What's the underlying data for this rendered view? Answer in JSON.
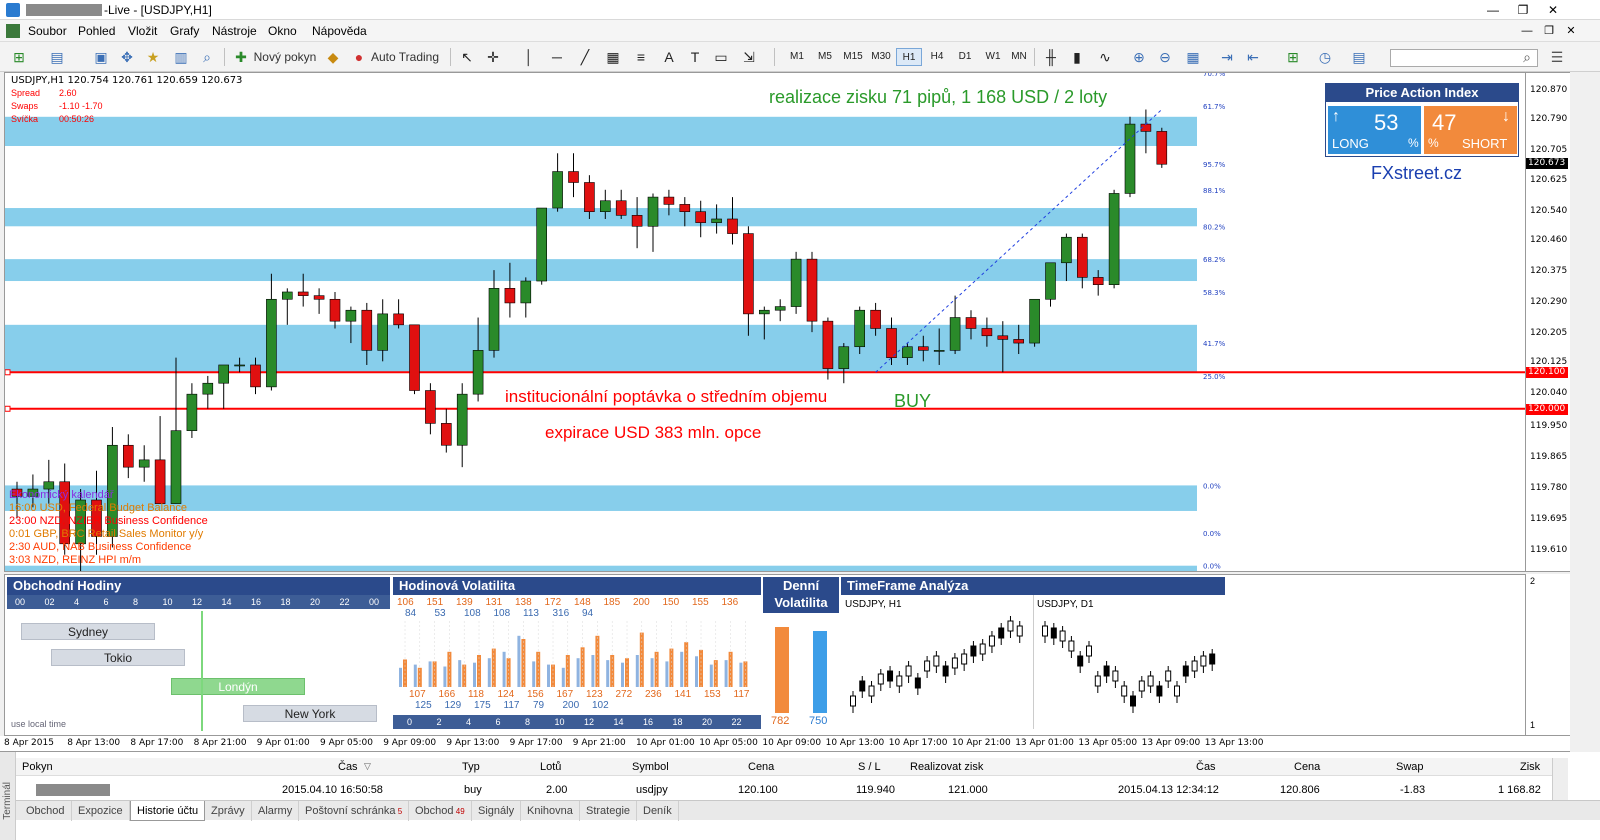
{
  "window": {
    "title_suffix": "-Live - [USDJPY,H1]",
    "controls": [
      "—",
      "❐",
      "✕"
    ],
    "mdi_controls": [
      "—",
      "❐",
      "✕"
    ]
  },
  "menu": [
    "Soubor",
    "Pohled",
    "Vložit",
    "Grafy",
    "Nástroje",
    "Okno",
    "Nápověda"
  ],
  "toolbar": {
    "new_order": "Nový pokyn",
    "auto_trading": "Auto Trading",
    "timeframes": [
      "M1",
      "M5",
      "M15",
      "M30",
      "H1",
      "H4",
      "D1",
      "W1",
      "MN"
    ],
    "active_timeframe": "H1"
  },
  "chart": {
    "header": "USDJPY,H1  120.754 120.761 120.659 120.673",
    "info": [
      {
        "label": "Spread",
        "value": "2.60"
      },
      {
        "label": "Swaps",
        "value": "-1.10 -1.70"
      },
      {
        "label": "Svíčka",
        "value": "00:50:26"
      }
    ],
    "annotations": {
      "profit": "realizace zisku 71 pipů, 1 168 USD / 2 loty",
      "demand": "institucionální poptávka o středním objemu",
      "expiry": "expirace USD 383 mln. opce",
      "buy": "BUY"
    },
    "price_ticks": [
      "120.870",
      "120.790",
      "120.705",
      "120.625",
      "120.540",
      "120.460",
      "120.375",
      "120.290",
      "120.205",
      "120.125",
      "120.040",
      "119.950",
      "119.865",
      "119.780",
      "119.695",
      "119.610"
    ],
    "price_tags": [
      {
        "label": "120.673",
        "color": "#000000"
      },
      {
        "label": "120.100",
        "color": "#ff0000"
      },
      {
        "label": "120.000",
        "color": "#ff0000"
      }
    ],
    "sub_axis": [
      "2",
      "1"
    ],
    "fib_labels": [
      "70.7%",
      "61.7%",
      "95.7%",
      "88.1%",
      "80.2%",
      "68.2%",
      "58.3%",
      "41.7%",
      "25.0%",
      "0.0%",
      "0.0%",
      "0.0%"
    ],
    "calendar_title": "Ekonomický kalendář",
    "calendar": [
      {
        "text": "16:00 USD, Federal Budget Balance",
        "color": "#e07b00"
      },
      {
        "text": "23:00 NZD, NZIER Business Confidence",
        "color": "#ff0000"
      },
      {
        "text": "0:01 GBP, BRC Retail Sales Monitor y/y",
        "color": "#e07b00"
      },
      {
        "text": "2:30 AUD, NAB Business Confidence",
        "color": "#ff3c00"
      },
      {
        "text": "3:03 NZD, REINZ HPI m/m",
        "color": "#ff3c00"
      }
    ]
  },
  "price_action_index": {
    "title": "Price Action Index",
    "long_value": "53",
    "short_value": "47",
    "pct": "%",
    "long_label": "LONG",
    "short_label": "SHORT",
    "brand": "FXstreet.cz",
    "colors": {
      "long": "#2f8fd8",
      "short": "#f28a3c"
    }
  },
  "trading_hours": {
    "title": "Obchodní Hodiny",
    "hours": [
      "00",
      "02",
      "4",
      "6",
      "8",
      "10",
      "12",
      "14",
      "16",
      "18",
      "20",
      "22",
      "00"
    ],
    "sessions": [
      "Sydney",
      "Tokio",
      "Londýn",
      "New York"
    ],
    "footer": "use local time"
  },
  "hourly_volatility": {
    "title": "Hodinová Volatilita",
    "top_orange": [
      "106",
      "151",
      "139",
      "131",
      "138",
      "172",
      "148",
      "185",
      "200",
      "150",
      "155",
      "136"
    ],
    "top_blue": [
      "84",
      "53",
      "108",
      "108",
      "113",
      "316",
      "94"
    ],
    "bottom_orange": [
      "107",
      "166",
      "118",
      "124",
      "156",
      "167",
      "123",
      "272",
      "236",
      "141",
      "153",
      "117"
    ],
    "bottom_blue": [
      "125",
      "129",
      "175",
      "117",
      "79",
      "200",
      "102"
    ],
    "axis": [
      "0",
      "2",
      "4",
      "6",
      "8",
      "10",
      "12",
      "14",
      "16",
      "18",
      "20",
      "22"
    ],
    "bars_orange": [
      0.43,
      0.3,
      0.4,
      0.55,
      0.35,
      0.5,
      0.6,
      0.45,
      0.75,
      0.55,
      0.35,
      0.5,
      0.62,
      0.8,
      0.5,
      0.45,
      0.85,
      0.55,
      0.6,
      0.7,
      0.58,
      0.42,
      0.55,
      0.4
    ],
    "bars_blue": [
      0.3,
      0.35,
      0.4,
      0.32,
      0.42,
      0.38,
      0.45,
      0.55,
      0.8,
      0.4,
      0.35,
      0.3,
      0.45,
      0.5,
      0.42,
      0.38,
      0.5,
      0.45,
      0.4,
      0.55,
      0.48,
      0.35,
      0.42,
      0.38
    ]
  },
  "daily_volatility": {
    "title": "Denní Volatilita",
    "orange_value": "782",
    "blue_value": "750"
  },
  "timeframe_analysis": {
    "title": "TimeFrame Analýza",
    "left_label": "USDJPY, H1",
    "right_label": "USDJPY, D1"
  },
  "time_axis": [
    "8 Apr 2015",
    "8 Apr 13:00",
    "8 Apr 17:00",
    "8 Apr 21:00",
    "9 Apr 01:00",
    "9 Apr 05:00",
    "9 Apr 09:00",
    "9 Apr 13:00",
    "9 Apr 17:00",
    "9 Apr 21:00",
    "10 Apr 01:00",
    "10 Apr 05:00",
    "10 Apr 09:00",
    "10 Apr 13:00",
    "10 Apr 17:00",
    "10 Apr 21:00",
    "13 Apr 01:00",
    "13 Apr 05:00",
    "13 Apr 09:00",
    "13 Apr 13:00"
  ],
  "terminal": {
    "side_label": "Terminál",
    "headers": [
      "Pokyn",
      "Čas",
      "Typ",
      "Lotů",
      "Symbol",
      "Cena",
      "S / L",
      "Realizovat zisk",
      "Čas",
      "Cena",
      "Swap",
      "Zisk"
    ],
    "row": [
      "2015.04.10 16:50:58",
      "buy",
      "2.00",
      "usdjpy",
      "120.100",
      "119.940",
      "121.000",
      "2015.04.13 12:34:12",
      "120.806",
      "-1.83",
      "1 168.82"
    ],
    "tabs": [
      {
        "label": "Obchod"
      },
      {
        "label": "Expozice"
      },
      {
        "label": "Historie účtu",
        "active": true
      },
      {
        "label": "Zprávy"
      },
      {
        "label": "Alarmy"
      },
      {
        "label": "Poštovní schránka",
        "badge": "5"
      },
      {
        "label": "Obchod",
        "badge": "49"
      },
      {
        "label": "Signály"
      },
      {
        "label": "Knihovna"
      },
      {
        "label": "Strategie"
      },
      {
        "label": "Deník"
      }
    ]
  },
  "candles": [
    {
      "o": 119.78,
      "h": 119.8,
      "l": 119.7,
      "c": 119.76
    },
    {
      "o": 119.76,
      "h": 119.82,
      "l": 119.73,
      "c": 119.78
    },
    {
      "o": 119.78,
      "h": 119.86,
      "l": 119.74,
      "c": 119.8
    },
    {
      "o": 119.8,
      "h": 119.85,
      "l": 119.6,
      "c": 119.63
    },
    {
      "o": 119.63,
      "h": 119.78,
      "l": 119.55,
      "c": 119.75
    },
    {
      "o": 119.75,
      "h": 119.83,
      "l": 119.6,
      "c": 119.65
    },
    {
      "o": 119.65,
      "h": 119.95,
      "l": 119.62,
      "c": 119.9
    },
    {
      "o": 119.9,
      "h": 119.93,
      "l": 119.81,
      "c": 119.84
    },
    {
      "o": 119.84,
      "h": 119.9,
      "l": 119.8,
      "c": 119.86
    },
    {
      "o": 119.86,
      "h": 119.98,
      "l": 119.78,
      "c": 119.74
    },
    {
      "o": 119.74,
      "h": 120.14,
      "l": 119.74,
      "c": 119.94
    },
    {
      "o": 119.94,
      "h": 120.07,
      "l": 119.92,
      "c": 120.04
    },
    {
      "o": 120.04,
      "h": 120.09,
      "l": 120.0,
      "c": 120.07
    },
    {
      "o": 120.07,
      "h": 120.1,
      "l": 120.0,
      "c": 120.12
    },
    {
      "o": 120.12,
      "h": 120.14,
      "l": 120.1,
      "c": 120.12
    },
    {
      "o": 120.12,
      "h": 120.14,
      "l": 120.04,
      "c": 120.06
    },
    {
      "o": 120.06,
      "h": 120.37,
      "l": 120.05,
      "c": 120.3
    },
    {
      "o": 120.3,
      "h": 120.33,
      "l": 120.23,
      "c": 120.32
    },
    {
      "o": 120.32,
      "h": 120.37,
      "l": 120.28,
      "c": 120.31
    },
    {
      "o": 120.31,
      "h": 120.33,
      "l": 120.26,
      "c": 120.3
    },
    {
      "o": 120.3,
      "h": 120.32,
      "l": 120.22,
      "c": 120.24
    },
    {
      "o": 120.24,
      "h": 120.28,
      "l": 120.18,
      "c": 120.27
    },
    {
      "o": 120.27,
      "h": 120.29,
      "l": 120.12,
      "c": 120.16
    },
    {
      "o": 120.16,
      "h": 120.3,
      "l": 120.13,
      "c": 120.26
    },
    {
      "o": 120.26,
      "h": 120.3,
      "l": 120.22,
      "c": 120.23
    },
    {
      "o": 120.23,
      "h": 120.23,
      "l": 120.04,
      "c": 120.05
    },
    {
      "o": 120.05,
      "h": 120.07,
      "l": 119.93,
      "c": 119.96
    },
    {
      "o": 119.96,
      "h": 120.0,
      "l": 119.88,
      "c": 119.9
    },
    {
      "o": 119.9,
      "h": 120.07,
      "l": 119.84,
      "c": 120.04
    },
    {
      "o": 120.04,
      "h": 120.25,
      "l": 120.02,
      "c": 120.16
    },
    {
      "o": 120.16,
      "h": 120.38,
      "l": 120.14,
      "c": 120.33
    },
    {
      "o": 120.33,
      "h": 120.4,
      "l": 120.25,
      "c": 120.29
    },
    {
      "o": 120.29,
      "h": 120.36,
      "l": 120.25,
      "c": 120.35
    },
    {
      "o": 120.35,
      "h": 120.55,
      "l": 120.34,
      "c": 120.55
    },
    {
      "o": 120.55,
      "h": 120.7,
      "l": 120.54,
      "c": 120.65
    },
    {
      "o": 120.65,
      "h": 120.7,
      "l": 120.58,
      "c": 120.62
    },
    {
      "o": 120.62,
      "h": 120.64,
      "l": 120.52,
      "c": 120.54
    },
    {
      "o": 120.54,
      "h": 120.6,
      "l": 120.52,
      "c": 120.57
    },
    {
      "o": 120.57,
      "h": 120.6,
      "l": 120.52,
      "c": 120.53
    },
    {
      "o": 120.53,
      "h": 120.58,
      "l": 120.44,
      "c": 120.5
    },
    {
      "o": 120.5,
      "h": 120.59,
      "l": 120.43,
      "c": 120.58
    },
    {
      "o": 120.58,
      "h": 120.6,
      "l": 120.53,
      "c": 120.56
    },
    {
      "o": 120.56,
      "h": 120.58,
      "l": 120.5,
      "c": 120.54
    },
    {
      "o": 120.54,
      "h": 120.57,
      "l": 120.47,
      "c": 120.51
    },
    {
      "o": 120.51,
      "h": 120.56,
      "l": 120.48,
      "c": 120.52
    },
    {
      "o": 120.52,
      "h": 120.58,
      "l": 120.45,
      "c": 120.48
    },
    {
      "o": 120.48,
      "h": 120.5,
      "l": 120.2,
      "c": 120.26
    },
    {
      "o": 120.26,
      "h": 120.28,
      "l": 120.19,
      "c": 120.27
    },
    {
      "o": 120.27,
      "h": 120.3,
      "l": 120.24,
      "c": 120.28
    },
    {
      "o": 120.28,
      "h": 120.43,
      "l": 120.26,
      "c": 120.41
    },
    {
      "o": 120.41,
      "h": 120.43,
      "l": 120.21,
      "c": 120.24
    },
    {
      "o": 120.24,
      "h": 120.25,
      "l": 120.08,
      "c": 120.11
    },
    {
      "o": 120.11,
      "h": 120.18,
      "l": 120.07,
      "c": 120.17
    },
    {
      "o": 120.17,
      "h": 120.28,
      "l": 120.15,
      "c": 120.27
    },
    {
      "o": 120.27,
      "h": 120.29,
      "l": 120.2,
      "c": 120.22
    },
    {
      "o": 120.22,
      "h": 120.25,
      "l": 120.12,
      "c": 120.14
    },
    {
      "o": 120.14,
      "h": 120.18,
      "l": 120.12,
      "c": 120.17
    },
    {
      "o": 120.17,
      "h": 120.2,
      "l": 120.13,
      "c": 120.16
    },
    {
      "o": 120.16,
      "h": 120.22,
      "l": 120.12,
      "c": 120.16
    },
    {
      "o": 120.16,
      "h": 120.31,
      "l": 120.15,
      "c": 120.25
    },
    {
      "o": 120.25,
      "h": 120.27,
      "l": 120.19,
      "c": 120.22
    },
    {
      "o": 120.22,
      "h": 120.25,
      "l": 120.17,
      "c": 120.2
    },
    {
      "o": 120.2,
      "h": 120.24,
      "l": 120.1,
      "c": 120.19
    },
    {
      "o": 120.19,
      "h": 120.23,
      "l": 120.15,
      "c": 120.18
    },
    {
      "o": 120.18,
      "h": 120.3,
      "l": 120.17,
      "c": 120.3
    },
    {
      "o": 120.3,
      "h": 120.4,
      "l": 120.28,
      "c": 120.4
    },
    {
      "o": 120.4,
      "h": 120.48,
      "l": 120.35,
      "c": 120.47
    },
    {
      "o": 120.47,
      "h": 120.48,
      "l": 120.33,
      "c": 120.36
    },
    {
      "o": 120.36,
      "h": 120.38,
      "l": 120.31,
      "c": 120.34
    },
    {
      "o": 120.34,
      "h": 120.6,
      "l": 120.33,
      "c": 120.59
    },
    {
      "o": 120.59,
      "h": 120.8,
      "l": 120.58,
      "c": 120.78
    },
    {
      "o": 120.78,
      "h": 120.82,
      "l": 120.7,
      "c": 120.76
    },
    {
      "o": 120.76,
      "h": 120.77,
      "l": 120.66,
      "c": 120.67
    }
  ]
}
